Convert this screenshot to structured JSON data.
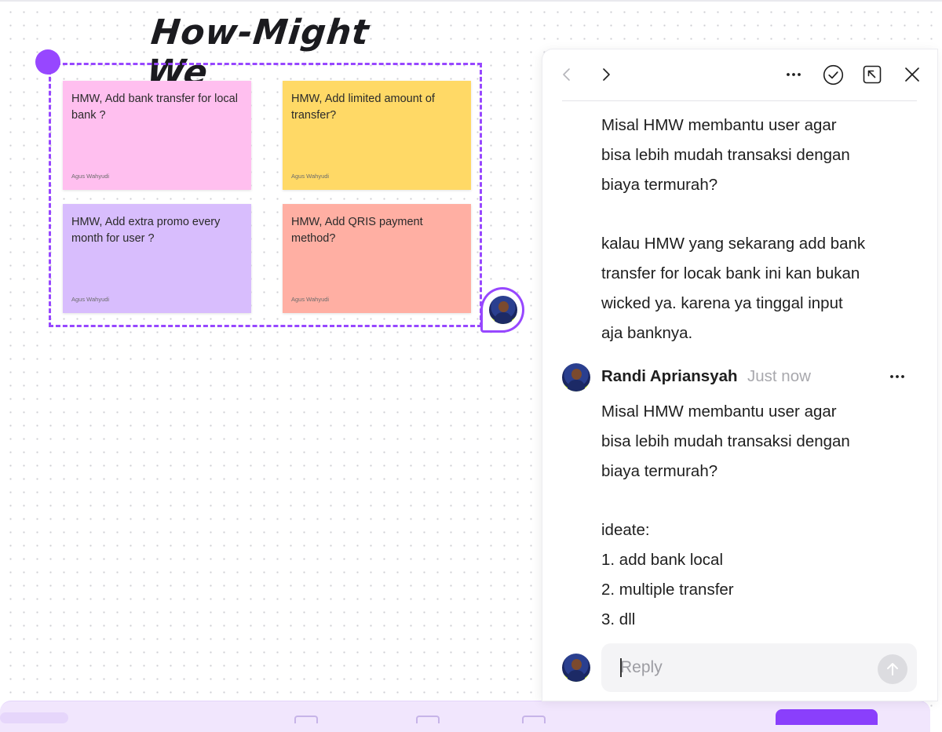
{
  "board": {
    "section_title": "How-Might We",
    "stickies": [
      {
        "text": "HMW, Add bank transfer for local bank ?",
        "author": "Agus Wahyudi",
        "color": "#ffbfef"
      },
      {
        "text": "HMW, Add limited amount of transfer?",
        "author": "Agus Wahyudi",
        "color": "#ffd966"
      },
      {
        "text": "HMW, Add extra promo every month for user ?",
        "author": "Agus Wahyudi",
        "color": "#d8bdfd"
      },
      {
        "text": "HMW, Add QRIS payment method?",
        "author": "Agus Wahyudi",
        "color": "#ffafa3"
      }
    ],
    "selection_color": "#9747ff"
  },
  "comments_panel": {
    "header_icons": [
      "chevron-left-icon",
      "chevron-right-icon",
      "more-horizontal-icon",
      "resolve-check-icon",
      "open-external-icon",
      "close-icon"
    ],
    "first_comment_body": "Misal HMW membantu user agar\nbisa lebih mudah transaksi dengan\nbiaya termurah?\n\nkalau HMW yang sekarang add bank\ntransfer for locak bank ini kan bukan\nwicked ya. karena ya tinggal input\naja banknya.",
    "reply": {
      "author": "Randi Apriansyah",
      "time": "Just now",
      "body": "Misal HMW membantu user agar\nbisa lebih mudah transaksi dengan\nbiaya termurah?\n\nideate:\n1. add bank local\n2. multiple transfer\n3. dll"
    },
    "reply_input": {
      "value": "",
      "placeholder": "Reply"
    }
  },
  "colors": {
    "accent": "#9747ff",
    "primary_button": "#8a3ffc"
  }
}
